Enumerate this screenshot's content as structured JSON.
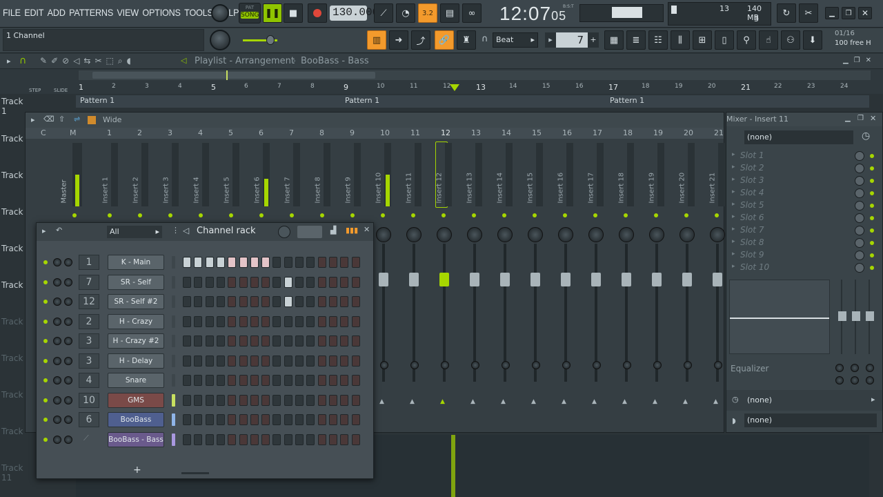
{
  "menu": [
    "FILE",
    "EDIT",
    "ADD",
    "PATTERNS",
    "VIEW",
    "OPTIONS",
    "TOOLS",
    "HELP"
  ],
  "transport": {
    "song_label": "SONG",
    "pat_label": "PAT",
    "bpm": "130.000",
    "time_main": "12:07",
    "time_sub": "05",
    "time_mode": "B:S:T",
    "snap": "Beat",
    "step_value": "7"
  },
  "status": {
    "cpu": "13",
    "memory": "140 MB",
    "poly": "3",
    "pattern_pos": "01/16",
    "free": "100 free H"
  },
  "hint": "1 Channel",
  "playlist": {
    "title": "Playlist - Arrangement",
    "crumb": "BooBass - Bass",
    "step_label": "STEP",
    "slide_label": "SLIDE",
    "bars": [
      "1",
      "2",
      "3",
      "4",
      "5",
      "6",
      "7",
      "8",
      "9",
      "10",
      "11",
      "12",
      "13",
      "14",
      "15",
      "16",
      "17",
      "18",
      "19",
      "20",
      "21",
      "22",
      "23",
      "24"
    ],
    "track1": "Track 1",
    "tracks": [
      "Track",
      "Track",
      "Track",
      "Track",
      "Track",
      "Track",
      "Track",
      "Track",
      "Track",
      "Track 11"
    ],
    "patterns": [
      "Pattern 1",
      "Pattern 1",
      "Pattern 1"
    ]
  },
  "mixer": {
    "view": "Wide",
    "header_cols": [
      "C",
      "M"
    ],
    "master": "Master",
    "inserts": [
      "Insert 1",
      "Insert 2",
      "Insert 3",
      "Insert 4",
      "Insert 5",
      "Insert 6",
      "Insert 7",
      "Insert 8",
      "Insert 9",
      "Insert 10",
      "Insert 11",
      "Insert 12",
      "Insert 13",
      "Insert 14",
      "Insert 15",
      "Insert 16",
      "Insert 17",
      "Insert 18",
      "Insert 19",
      "Insert 20",
      "Insert 21"
    ],
    "numbers": [
      "1",
      "2",
      "3",
      "4",
      "5",
      "6",
      "7",
      "8",
      "9",
      "10",
      "11",
      "12",
      "13",
      "14",
      "15",
      "16",
      "17",
      "18",
      "19",
      "20",
      "21"
    ],
    "selected": "12"
  },
  "insert_panel": {
    "title": "Mixer - Insert 11",
    "input": "(none)",
    "slots": [
      "Slot 1",
      "Slot 2",
      "Slot 3",
      "Slot 4",
      "Slot 5",
      "Slot 6",
      "Slot 7",
      "Slot 8",
      "Slot 9",
      "Slot 10"
    ],
    "eq_label": "Equalizer",
    "out1": "(none)",
    "out2": "(none)"
  },
  "channel_rack": {
    "title": "Channel rack",
    "filter": "All",
    "add_label": "+",
    "channels": [
      {
        "num": "1",
        "name": "K - Main",
        "color": "#5a646a",
        "steps": "111111110000000000"
      },
      {
        "num": "7",
        "name": "SR - Self",
        "color": "#5a646a",
        "steps": "000000000100000000"
      },
      {
        "num": "12",
        "name": "SR - Self #2",
        "color": "#5a646a",
        "steps": "000000000100000000"
      },
      {
        "num": "2",
        "name": "H - Crazy",
        "color": "#5a646a",
        "steps": "000000000000000000"
      },
      {
        "num": "3",
        "name": "H - Crazy #2",
        "color": "#5a646a",
        "steps": "000000000000000000"
      },
      {
        "num": "3",
        "name": "H - Delay",
        "color": "#5a646a",
        "steps": "000000000000000000"
      },
      {
        "num": "4",
        "name": "Snare",
        "color": "#5a646a",
        "steps": "000000000000000000"
      },
      {
        "num": "10",
        "name": "GMS",
        "color": "#7a4a48",
        "steps": "000000000000000000"
      },
      {
        "num": "6",
        "name": "BooBass",
        "color": "#4f5f8f",
        "steps": "000000000000000000"
      },
      {
        "num": "",
        "name": "BooBass - Bass",
        "color": "#6a5a8c",
        "steps": "000000000000000000"
      }
    ]
  },
  "colors": {
    "accent": "#f39a2c",
    "led": "#a6d600",
    "bg": "#2e373c"
  }
}
